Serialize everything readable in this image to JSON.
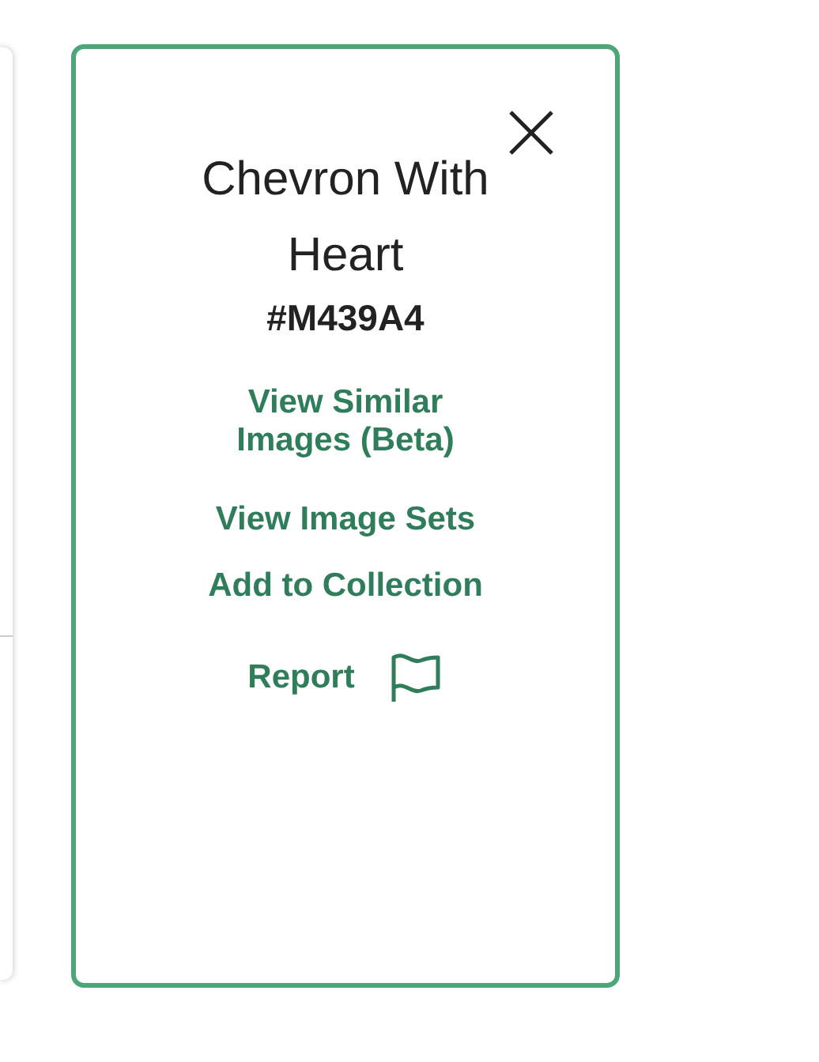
{
  "popup": {
    "title": "Chevron With Heart",
    "code": "#M439A4",
    "links": [
      {
        "label": "View Similar Images (Beta)",
        "kind": "text"
      },
      {
        "label": "View Image Sets",
        "kind": "text"
      },
      {
        "label": "Add to Collection",
        "kind": "text"
      },
      {
        "label": "Report",
        "kind": "flag"
      }
    ]
  }
}
